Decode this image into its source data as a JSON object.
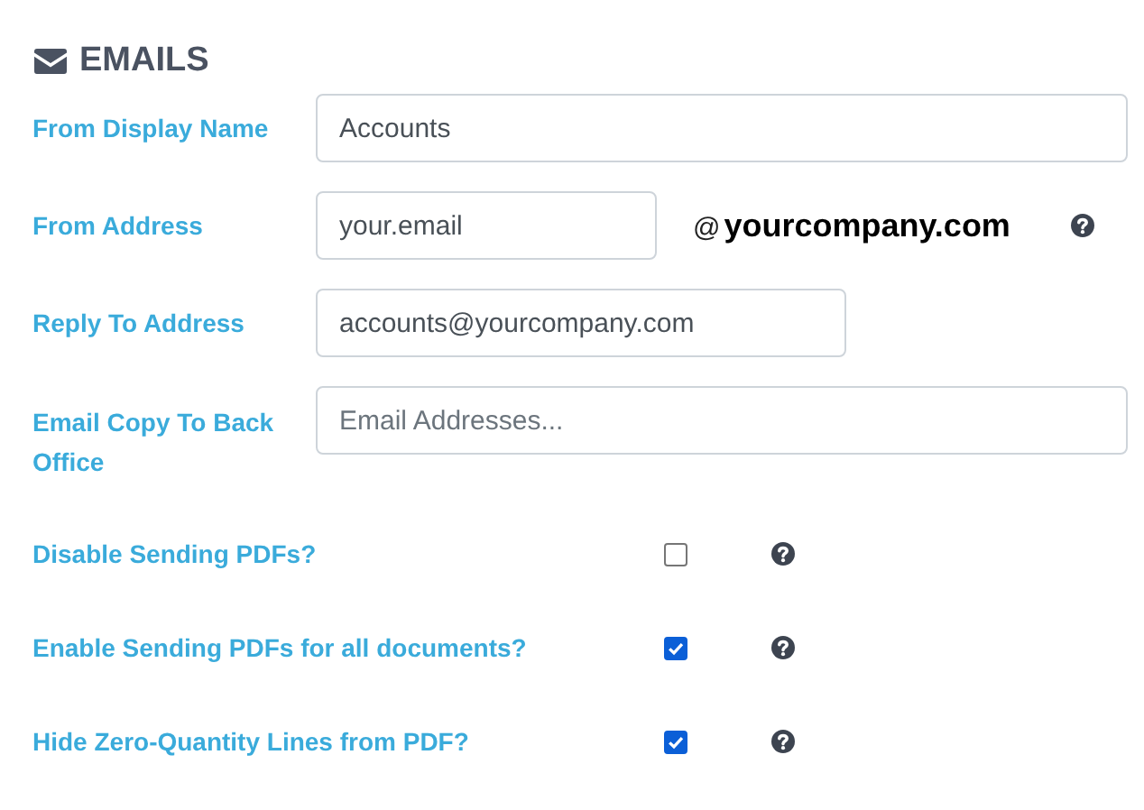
{
  "section": {
    "title": "EMAILS"
  },
  "fields": [
    {
      "kind": "text",
      "label": "From Display Name",
      "value": "Accounts"
    },
    {
      "kind": "suffixed",
      "label": "From Address",
      "value": "your.email",
      "suffix_at": "@",
      "suffix_domain": "yourcompany.com",
      "help": true
    },
    {
      "kind": "text",
      "label": "Reply To Address",
      "value": "accounts@yourcompany.com"
    },
    {
      "kind": "text",
      "label": "Email Copy To Back Office",
      "placeholder": "Email Addresses..."
    }
  ],
  "options": [
    {
      "label": "Disable Sending PDFs?",
      "checked": false,
      "help": true
    },
    {
      "label": "Enable Sending PDFs for all documents?",
      "checked": true,
      "help": true
    },
    {
      "label": "Hide Zero-Quantity Lines from PDF?",
      "checked": true,
      "help": true
    }
  ]
}
